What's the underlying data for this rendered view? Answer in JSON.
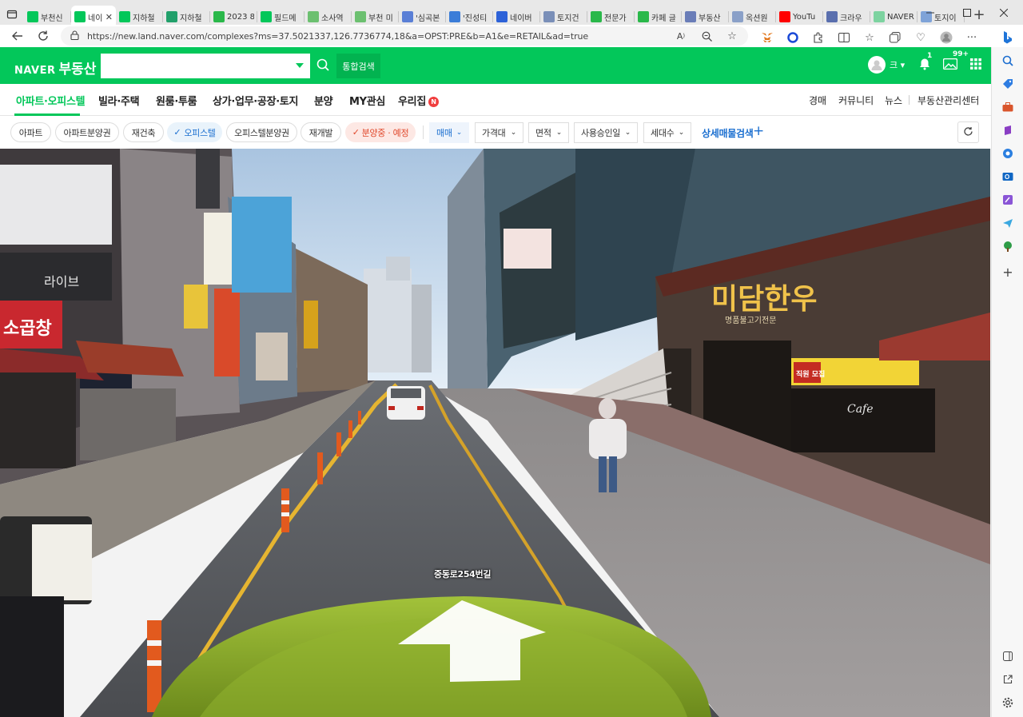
{
  "browser": {
    "tabs": [
      {
        "label": "부천신",
        "favicon": "naver-n-icon",
        "color": "#03c75a",
        "active": false
      },
      {
        "label": "네이",
        "favicon": "naver-n-icon",
        "color": "#03c75a",
        "active": true
      },
      {
        "label": "지하철",
        "favicon": "naver-n-icon",
        "color": "#03c75a",
        "active": false
      },
      {
        "label": "지하철",
        "favicon": "naver-map-icon",
        "color": "#22a06b",
        "active": false
      },
      {
        "label": "2023 8",
        "favicon": "cafe-icon",
        "color": "#2ab84a",
        "active": false
      },
      {
        "label": "필드메",
        "favicon": "naver-n-icon",
        "color": "#03c75a",
        "active": false
      },
      {
        "label": "소사역",
        "favicon": "blog-icon",
        "color": "#6cc070",
        "active": false
      },
      {
        "label": "부천 미",
        "favicon": "blog-icon",
        "color": "#6cc070",
        "active": false
      },
      {
        "label": "'심곡본",
        "favicon": "place-icon",
        "color": "#5a7fd6",
        "active": false
      },
      {
        "label": "'진성티",
        "favicon": "chart-icon",
        "color": "#3b7dd8",
        "active": false
      },
      {
        "label": "네이버",
        "favicon": "shield-icon",
        "color": "#2d62d8",
        "active": false
      },
      {
        "label": "토지건",
        "favicon": "doc-icon",
        "color": "#7a8fb8",
        "active": false
      },
      {
        "label": "전문가",
        "favicon": "cafe-icon",
        "color": "#2ab84a",
        "active": false
      },
      {
        "label": "카페 글",
        "favicon": "cafe-icon",
        "color": "#2ab84a",
        "active": false
      },
      {
        "label": "부동산",
        "favicon": "land-icon",
        "color": "#6a7db8",
        "active": false
      },
      {
        "label": "옥션원",
        "favicon": "auction-icon",
        "color": "#8aa0c8",
        "active": false
      },
      {
        "label": "YouTu",
        "favicon": "youtube-icon",
        "color": "#ff0000",
        "active": false
      },
      {
        "label": "크라우",
        "favicon": "crowd-icon",
        "color": "#5a6fae",
        "active": false
      },
      {
        "label": "NAVER",
        "favicon": "naver-n-icon",
        "color": "#7dd3a0",
        "active": false
      },
      {
        "label": "토지이",
        "favicon": "grid-icon",
        "color": "#7fa3d8",
        "active": false
      }
    ],
    "new_tab": "+",
    "url": "https://new.land.naver.com/complexes?ms=37.5021337,126.7736774,18&a=OPST:PRE&b=A1&e=RETAIL&ad=true"
  },
  "header": {
    "logo_naver": "NAVER",
    "logo_service": "부동산",
    "search_value": "",
    "total_search_label": "통합검색",
    "user_name": "크",
    "notification_count": "1",
    "message_count": "99+"
  },
  "nav": {
    "items": [
      {
        "label": "아파트·오피스텔",
        "active": true
      },
      {
        "label": "빌라·주택",
        "active": false
      },
      {
        "label": "원룸·투룸",
        "active": false
      },
      {
        "label": "상가·업무·공장·토지",
        "active": false
      },
      {
        "label": "분양",
        "active": false
      },
      {
        "label": "MY관심",
        "active": false
      },
      {
        "label": "우리집",
        "active": false
      }
    ],
    "new_badge": "N",
    "right_items": [
      "경매",
      "커뮤니티",
      "뉴스",
      "부동산관리센터"
    ]
  },
  "filters": {
    "chips": [
      {
        "label": "아파트",
        "state": "normal"
      },
      {
        "label": "아파트분양권",
        "state": "normal"
      },
      {
        "label": "재건축",
        "state": "normal"
      },
      {
        "label": "오피스텔",
        "state": "selected"
      },
      {
        "label": "오피스텔분양권",
        "state": "normal"
      },
      {
        "label": "재개발",
        "state": "normal"
      },
      {
        "label": "분양중 · 예정",
        "state": "selected-red"
      }
    ],
    "dropdowns": [
      {
        "label": "매매",
        "selected": true
      },
      {
        "label": "가격대",
        "selected": false
      },
      {
        "label": "면적",
        "selected": false
      },
      {
        "label": "사용승인일",
        "selected": false
      },
      {
        "label": "세대수",
        "selected": false
      }
    ],
    "advanced_search_label": "상세매물검색"
  },
  "streetview": {
    "road_label": "중동로254번길",
    "signs": {
      "restaurant_main": "미담한우",
      "restaurant_sub": "명품불고기전문",
      "recruit": "직원 모집",
      "left_sign": "소곱창",
      "left_sign2": "라이브",
      "cafe": "Cafe"
    }
  },
  "colors": {
    "naver_green": "#03c75a",
    "accent_blue": "#1b6fd0",
    "accent_red": "#e0482b"
  }
}
